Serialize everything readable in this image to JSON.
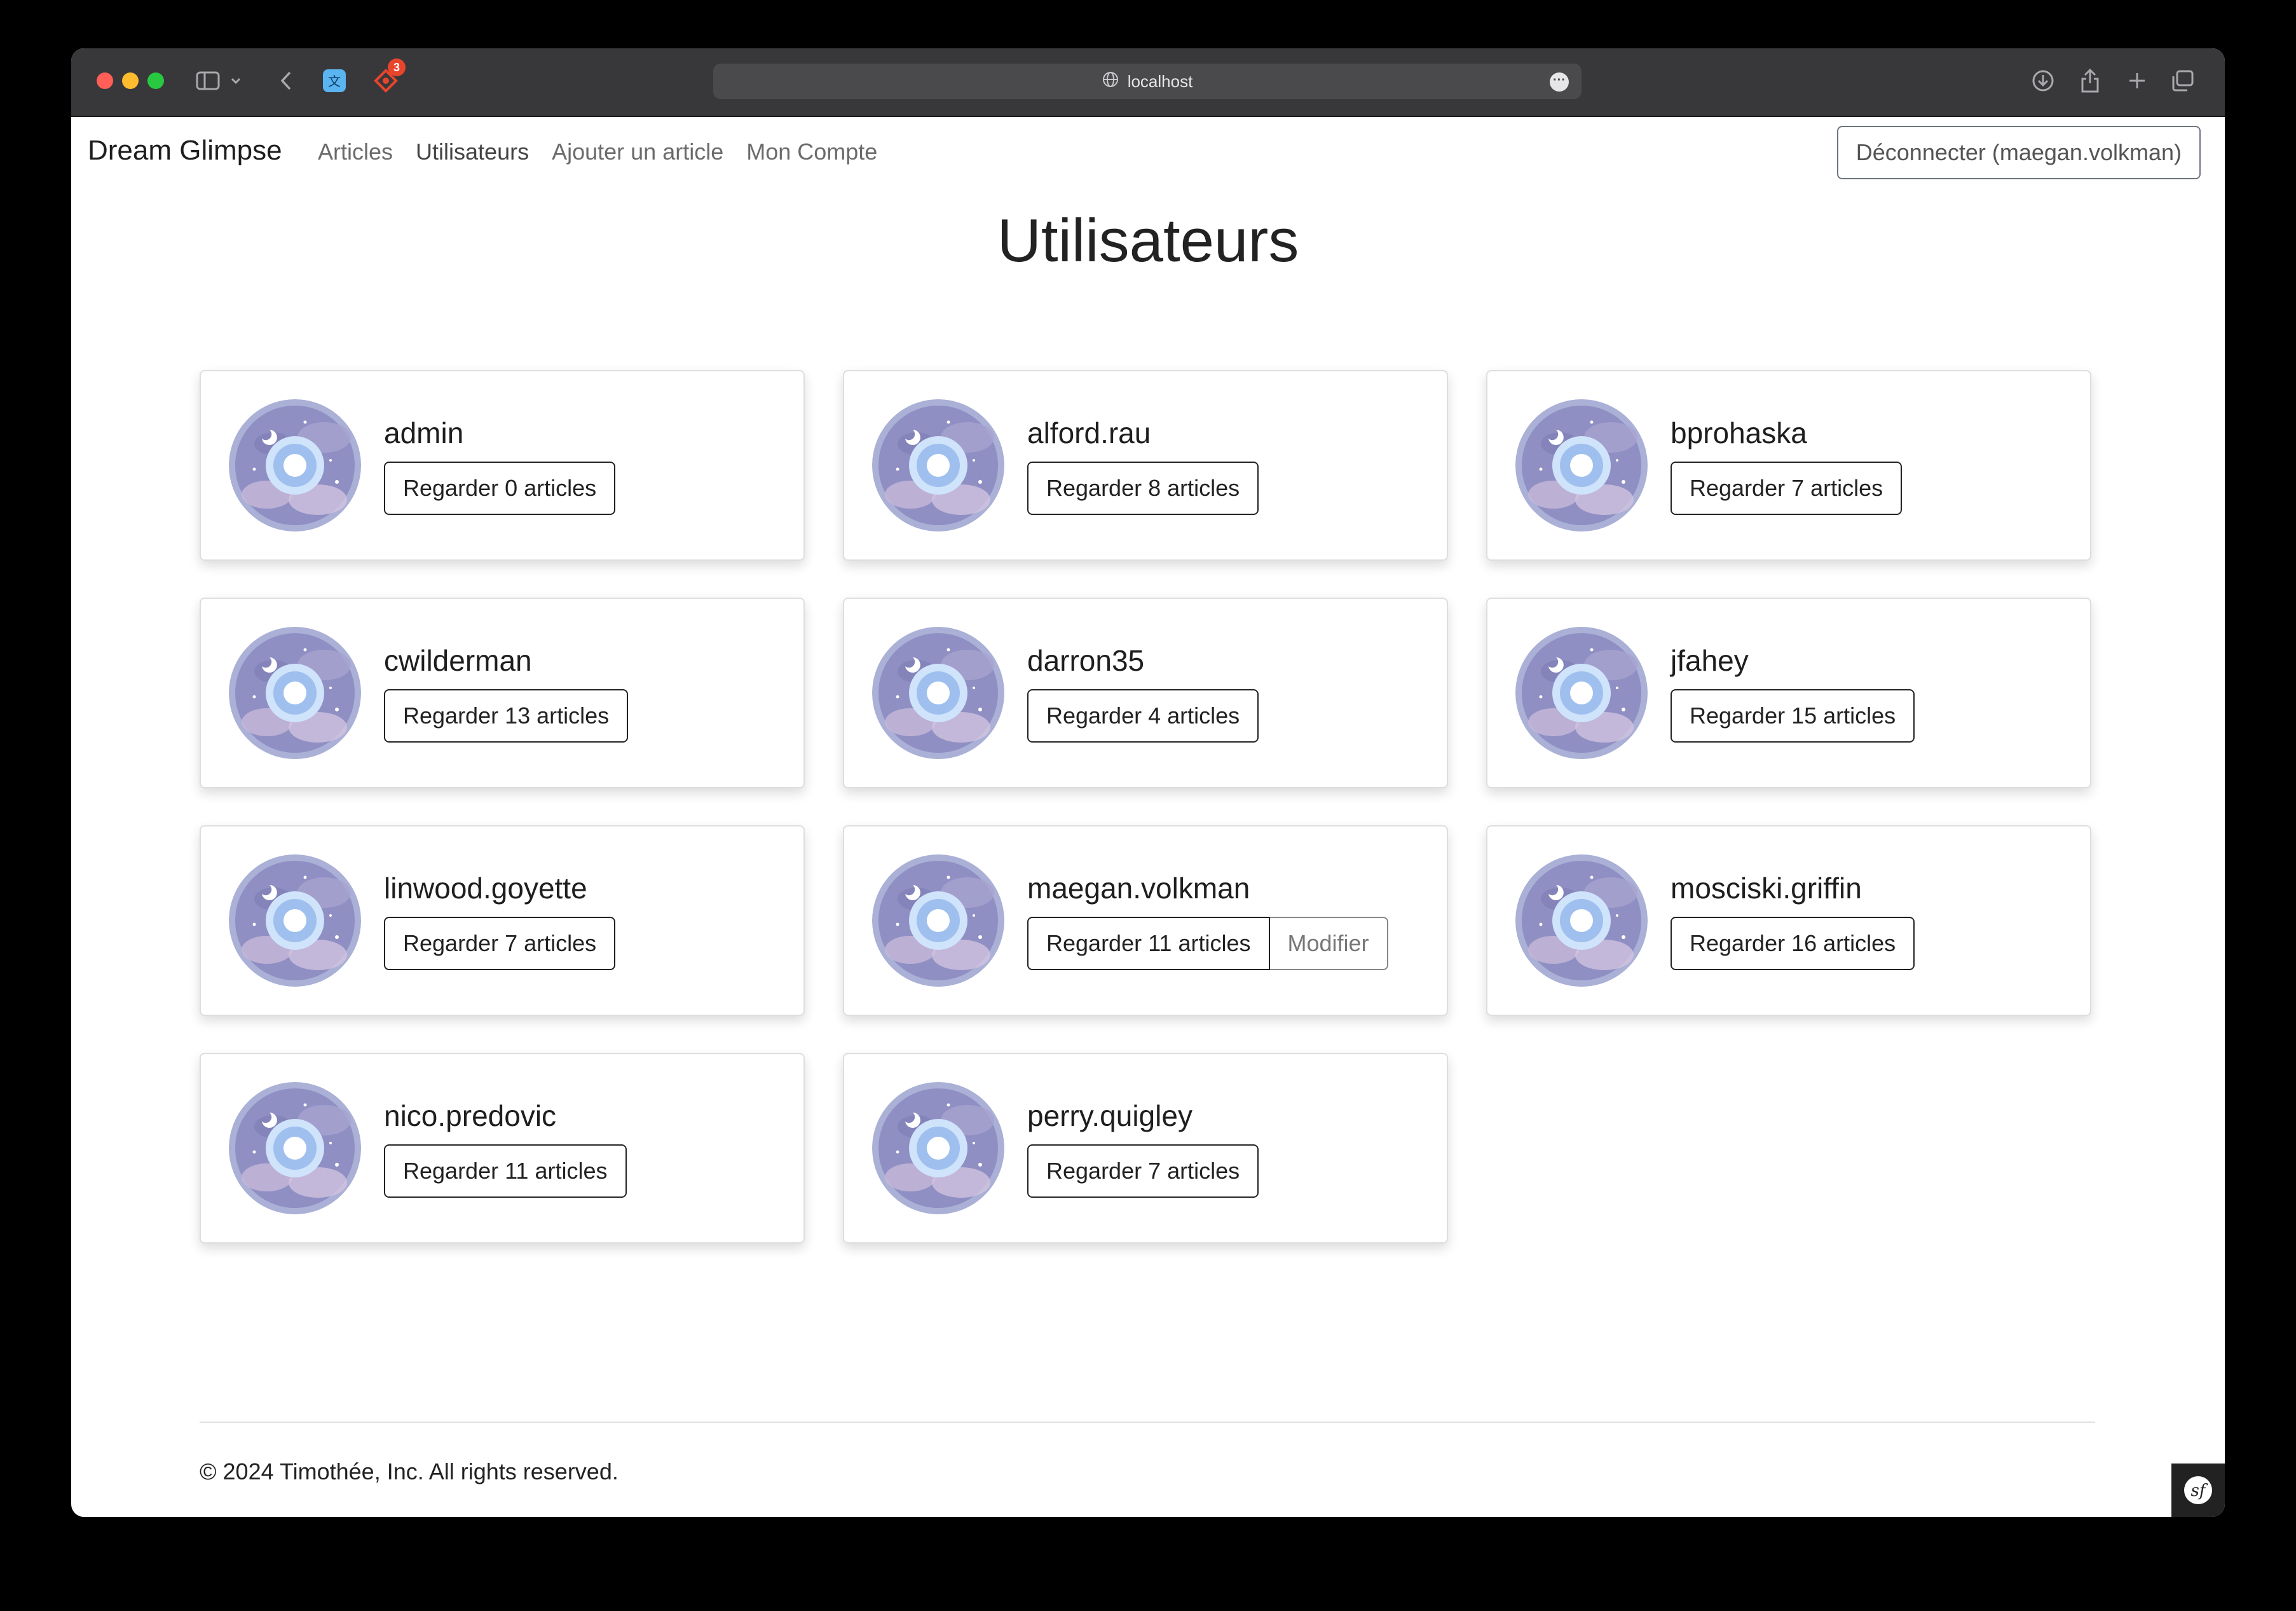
{
  "browser": {
    "url": "localhost",
    "extension_badge_count": "3"
  },
  "navbar": {
    "brand": "Dream Glimpse",
    "links": [
      "Articles",
      "Utilisateurs",
      "Ajouter un article",
      "Mon Compte"
    ],
    "logout_label": "Déconnecter (maegan.volkman)"
  },
  "page_title": "Utilisateurs",
  "users": [
    {
      "name": "admin",
      "view_label": "Regarder 0 articles"
    },
    {
      "name": "alford.rau",
      "view_label": "Regarder 8 articles"
    },
    {
      "name": "bprohaska",
      "view_label": "Regarder 7 articles"
    },
    {
      "name": "cwilderman",
      "view_label": "Regarder 13 articles"
    },
    {
      "name": "darron35",
      "view_label": "Regarder 4 articles"
    },
    {
      "name": "jfahey",
      "view_label": "Regarder 15 articles"
    },
    {
      "name": "linwood.goyette",
      "view_label": "Regarder 7 articles"
    },
    {
      "name": "maegan.volkman",
      "view_label": "Regarder 11 articles",
      "edit_label": "Modifier"
    },
    {
      "name": "mosciski.griffin",
      "view_label": "Regarder 16 articles"
    },
    {
      "name": "nico.predovic",
      "view_label": "Regarder 11 articles"
    },
    {
      "name": "perry.quigley",
      "view_label": "Regarder 7 articles"
    }
  ],
  "footer": {
    "text": "© 2024 Timothée, Inc. All rights reserved."
  },
  "colors": {
    "avatar_bg": "#8f8fc4",
    "avatar_ring": "#aab0d6",
    "avatar_center": "#cfe3fb"
  }
}
